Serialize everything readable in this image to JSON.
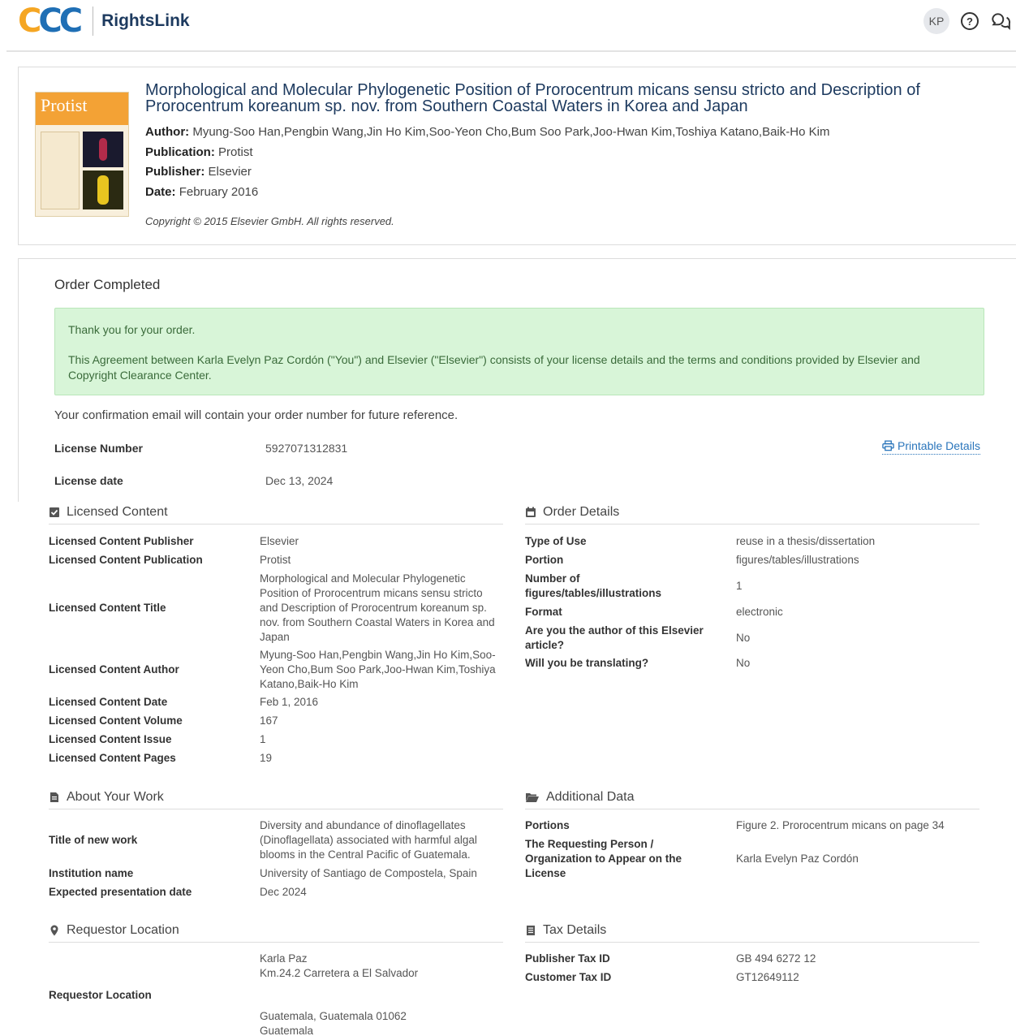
{
  "header": {
    "logo_letters": "CCC",
    "brand": "RightsLink",
    "avatar_initials": "KP",
    "help_glyph": "?"
  },
  "article": {
    "cover_title": "Protist",
    "title": "Morphological and Molecular Phylogenetic Position of Prorocentrum micans sensu stricto and Description of Prorocentrum koreanum sp. nov. from Southern Coastal Waters in Korea and Japan",
    "author_label": "Author:",
    "author": "Myung-Soo Han,Pengbin Wang,Jin Ho Kim,Soo-Yeon Cho,Bum Soo Park,Joo-Hwan Kim,Toshiya Katano,Baik-Ho Kim",
    "publication_label": "Publication:",
    "publication": "Protist",
    "publisher_label": "Publisher:",
    "publisher": "Elsevier",
    "date_label": "Date:",
    "date": "February 2016",
    "copyright": "Copyright © 2015 Elsevier GmbH. All rights reserved."
  },
  "order": {
    "title": "Order Completed",
    "thanks": "Thank you for your order.",
    "agreement": "This Agreement between Karla Evelyn Paz Cordón (\"You\") and Elsevier (\"Elsevier\") consists of your license details and the terms and conditions provided by Elsevier and Copyright Clearance Center.",
    "confirmation": "Your confirmation email will contain your order number for future reference.",
    "license_number_label": "License Number",
    "license_number": "5927071312831",
    "license_date_label": "License date",
    "license_date": "Dec 13, 2024",
    "printable": "Printable Details"
  },
  "licensed_content": {
    "heading": "Licensed Content",
    "rows": [
      {
        "k": "Licensed Content Publisher",
        "v": "Elsevier"
      },
      {
        "k": "Licensed Content Publication",
        "v": "Protist"
      },
      {
        "k": "Licensed Content Title",
        "v": "Morphological and Molecular Phylogenetic Position of Prorocentrum micans sensu stricto and Description of Prorocentrum koreanum sp. nov. from Southern Coastal Waters in Korea and Japan"
      },
      {
        "k": "Licensed Content Author",
        "v": "Myung-Soo Han,Pengbin Wang,Jin Ho Kim,Soo-Yeon Cho,Bum Soo Park,Joo-Hwan Kim,Toshiya Katano,Baik-Ho Kim"
      },
      {
        "k": "Licensed Content Date",
        "v": "Feb 1, 2016"
      },
      {
        "k": "Licensed Content Volume",
        "v": "167"
      },
      {
        "k": "Licensed Content Issue",
        "v": "1"
      },
      {
        "k": "Licensed Content Pages",
        "v": "19"
      }
    ]
  },
  "order_details": {
    "heading": "Order Details",
    "rows": [
      {
        "k": "Type of Use",
        "v": "reuse in a thesis/dissertation"
      },
      {
        "k": "Portion",
        "v": "figures/tables/illustrations"
      },
      {
        "k": "Number of figures/tables/illustrations",
        "v": "1"
      },
      {
        "k": "Format",
        "v": "electronic"
      },
      {
        "k": "Are you the author of this Elsevier article?",
        "v": "No"
      },
      {
        "k": "Will you be translating?",
        "v": "No"
      }
    ]
  },
  "about_work": {
    "heading": "About Your Work",
    "rows": [
      {
        "k": "Title of new work",
        "v": "Diversity and abundance of dinoflagellates (Dinoflagellata) associated with harmful algal blooms in the Central Pacific of Guatemala."
      },
      {
        "k": "Institution name",
        "v": "University of Santiago de Compostela, Spain"
      },
      {
        "k": "Expected presentation date",
        "v": "Dec 2024"
      }
    ]
  },
  "additional_data": {
    "heading": "Additional Data",
    "rows": [
      {
        "k": "Portions",
        "v": "Figure 2. Prorocentrum micans on page 34"
      },
      {
        "k": "The Requesting Person / Organization to Appear on the License",
        "v": "Karla Evelyn Paz Cordón"
      }
    ]
  },
  "requestor": {
    "heading": "Requestor Location",
    "label": "Requestor Location",
    "line1": "Karla Paz",
    "line2": "Km.24.2 Carretera a El Salvador",
    "line3": "Guatemala, Guatemala 01062",
    "line4": "Guatemala"
  },
  "tax": {
    "heading": "Tax Details",
    "rows": [
      {
        "k": "Publisher Tax ID",
        "v": "GB 494 6272 12"
      },
      {
        "k": "Customer Tax ID",
        "v": "GT12649112"
      }
    ]
  }
}
